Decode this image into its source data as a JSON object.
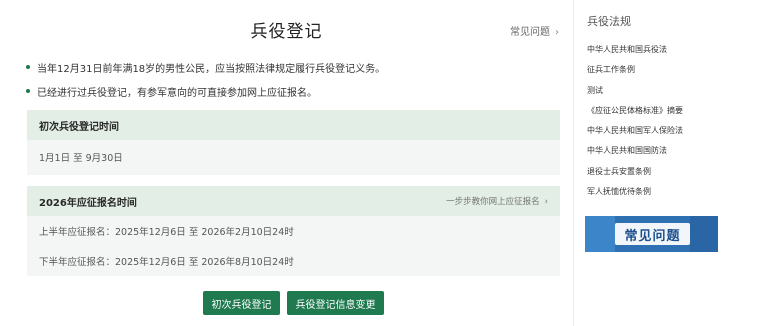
{
  "main": {
    "title": "兵役登记",
    "faq_link": "常见问题",
    "bullets": [
      "当年12月31日前年满18岁的男性公民，应当按照法律规定履行兵役登记义务。",
      "已经进行过兵役登记，有参军意向的可直接参加网上应征报名。"
    ],
    "first_registration": {
      "title": "初次兵役登记时间",
      "period": "1月1日 至 9月30日"
    },
    "enlistment": {
      "title": "2026年应征报名时间",
      "link": "一步步教你网上应征报名",
      "first_half": "上半年应征报名：2025年12月6日 至 2026年2月10日24时",
      "second_half": "下半年应征报名：2025年12月6日 至 2026年8月10日24时"
    },
    "buttons": {
      "first_registration": "初次兵役登记",
      "info_change": "兵役登记信息变更"
    }
  },
  "sidebar": {
    "title": "兵役法规",
    "items": [
      "中华人民共和国兵役法",
      "征兵工作条例",
      "测试",
      "《应征公民体格标准》摘要",
      "中华人民共和国军人保险法",
      "中华人民共和国国防法",
      "退役士兵安置条例",
      "军人抚恤优待条例"
    ],
    "banner": "常见问题"
  },
  "icons": {
    "chevron": "chevron-right-icon",
    "bullet": "bullet-dot-icon"
  },
  "colors": {
    "accent": "#1f7a4f",
    "card_header": "#e2eee6",
    "card_body": "#f4f6f5",
    "banner": "#2f70b3"
  }
}
